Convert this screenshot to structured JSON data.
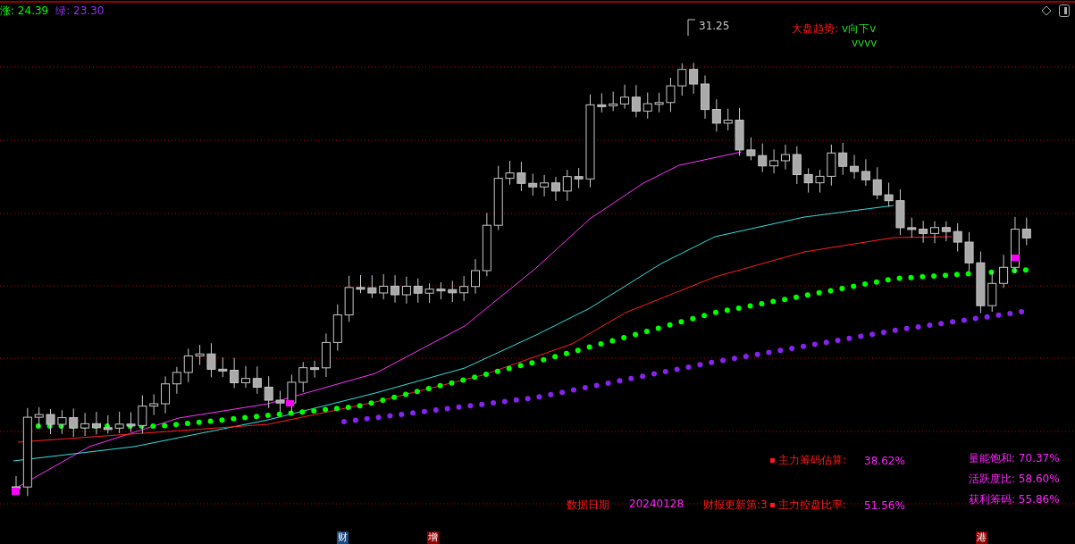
{
  "legend": [
    {
      "label": "涨:",
      "value": "24.39",
      "color": "#00ff00"
    },
    {
      "label": "绿:",
      "value": "23.30",
      "color": "#9933ff"
    }
  ],
  "peak_label": "31.25",
  "trend": {
    "label": "大盘趋势:",
    "value": "v向下v",
    "marks": "vvvv"
  },
  "main_stats": [
    {
      "label": "主力筹码估算:",
      "value": "38.62%"
    },
    {
      "label": "主力控盘比率:",
      "value": "51.56%"
    }
  ],
  "side_stats": [
    {
      "label": "量能饱和:",
      "value": "70.37%"
    },
    {
      "label": "活跃度比:",
      "value": "58.60%"
    },
    {
      "label": "获利筹码:",
      "value": "55.86%"
    }
  ],
  "data_date": {
    "label": "数据日期",
    "value": "20240128"
  },
  "report_update": "财报更新第:3",
  "event_badges": [
    {
      "text": "财",
      "color": "#1a4a80"
    },
    {
      "text": "增",
      "color": "#8b0000"
    },
    {
      "text": "港",
      "color": "#8b0000"
    }
  ]
}
